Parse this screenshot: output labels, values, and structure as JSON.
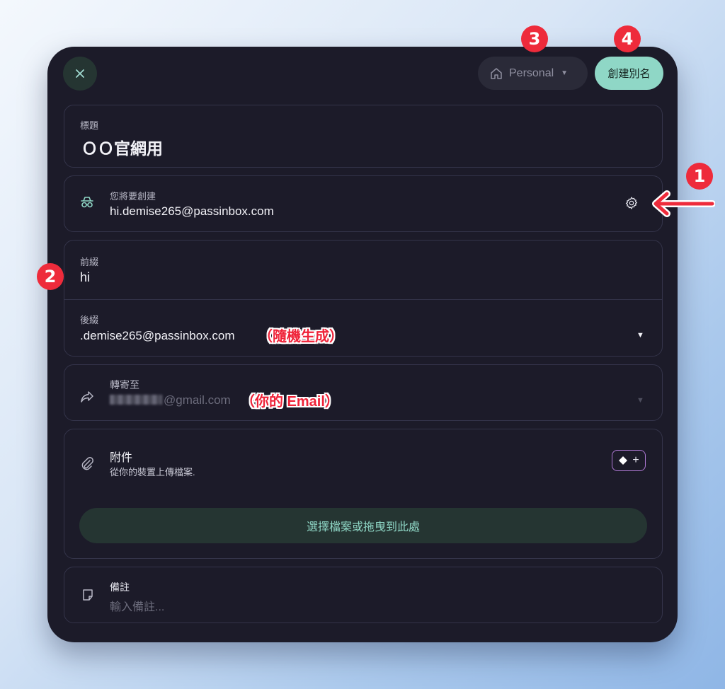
{
  "header": {
    "close_icon": "close-icon",
    "vault": {
      "label": "Personal",
      "icon": "home-icon"
    },
    "create_button": "創建別名"
  },
  "title_field": {
    "label": "標題",
    "value": "ＯＯ官網用"
  },
  "alias_preview": {
    "label": "您將要創建",
    "value": "hi.demise265@passinbox.com",
    "icon": "incognito-icon"
  },
  "prefix_field": {
    "label": "前綴",
    "value": "hi"
  },
  "suffix_field": {
    "label": "後綴",
    "value": ".demise265@passinbox.com"
  },
  "forward_field": {
    "label": "轉寄至",
    "value": "@gmail.com",
    "icon": "forward-icon"
  },
  "attachments": {
    "label": "附件",
    "hint": "從你的裝置上傳檔案.",
    "upload_button": "選擇檔案或拖曳到此處",
    "icon": "paperclip-icon"
  },
  "note_field": {
    "label": "備註",
    "placeholder": "輸入備註...",
    "icon": "note-icon"
  },
  "annotations": {
    "badges": [
      "1",
      "2",
      "3",
      "4"
    ],
    "suffix_note": "（隨機生成）",
    "forward_note": "（你的 Email）"
  },
  "colors": {
    "accent": "#8fd7c6",
    "badge": "#ee2b3b",
    "panel": "#1c1b29"
  }
}
